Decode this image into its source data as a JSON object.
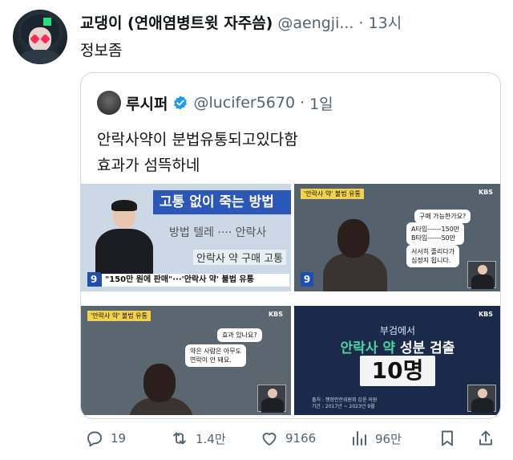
{
  "tweet": {
    "author_name": "교댕이 (연애염병트윗 자주씀)",
    "handle": "@aengji...",
    "separator": "·",
    "time": "13시",
    "text": "정보좀"
  },
  "quoted": {
    "author_name": "루시퍼",
    "handle": "@lucifer5670",
    "separator": "·",
    "time": "1일",
    "text_line1": "안락사약이 분법유통되고있다함",
    "text_line2": "효과가 섬뜩하네",
    "media": [
      {
        "band_text": "고통 없이 죽는 방법",
        "line2": "방법 텔레 ···· 안락사",
        "line3": "안락사 약 구매  고통",
        "channel_number": "9",
        "ticker": "\"150만 원에 판매\"···'안락사 약' 불법 유통"
      },
      {
        "tag": "'안락사 약' 불법 유통",
        "logo": "KBS",
        "bubble1": "구매 가능한가요?",
        "bubble2": "A타입------150만\nB타입------50만",
        "bubble3": "서서히 졸리다가\n심정지 됩니다.",
        "channel_number": "9"
      },
      {
        "tag": "'안락사 약' 불법 유통",
        "logo": "KBS",
        "bubble1": "효과 있나요?",
        "bubble2": "약은 사람은 아무도\n연락이 안 돼요."
      },
      {
        "logo": "KBS",
        "top": "부검에서",
        "mid_highlight": "안락사 약",
        "mid_rest": " 성분 검출",
        "number": "10명",
        "source": "출처 : 행정안전위원회 김윤 의원\n기간 : 2017년 ~ 2023년 9월"
      }
    ]
  },
  "actions": {
    "replies": "19",
    "retweets": "1.4만",
    "likes": "9166",
    "views": "96만"
  }
}
